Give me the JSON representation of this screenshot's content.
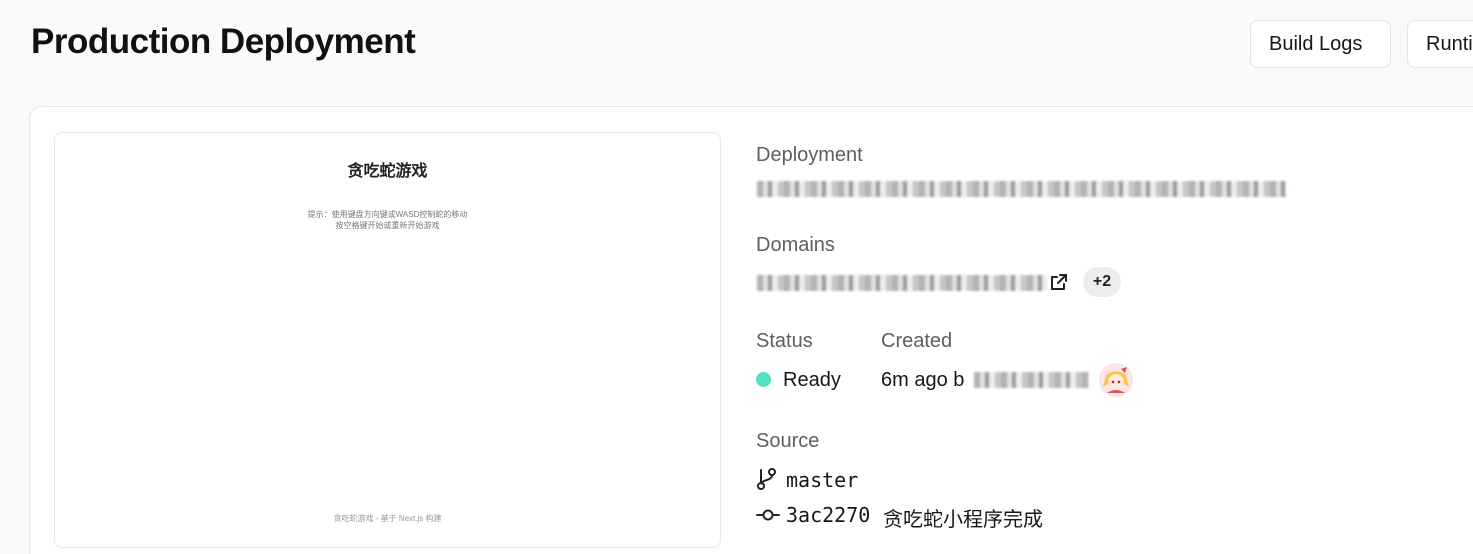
{
  "header": {
    "title": "Production Deployment",
    "buttons": {
      "build_logs": "Build Logs",
      "runtime_logs": "Runtime Logs"
    }
  },
  "preview": {
    "title": "贪吃蛇游戏",
    "hint_line1": "提示：使用键盘方向键或WASD控制蛇的移动",
    "hint_line2": "按空格键开始或重新开始游戏",
    "footer": "贪吃蛇游戏 - 基于 Next.js 构建"
  },
  "details": {
    "deployment_label": "Deployment",
    "domains_label": "Domains",
    "domains_more": "+2",
    "status_label": "Status",
    "status_value": "Ready",
    "status_color": "#50e3c2",
    "created_label": "Created",
    "created_value": "6m ago b",
    "source_label": "Source",
    "branch": "master",
    "commit_hash": "3ac2270",
    "commit_message": "贪吃蛇小程序完成"
  },
  "icons": {
    "external_link": "external-link-icon",
    "branch": "git-branch-icon",
    "commit": "git-commit-icon"
  }
}
